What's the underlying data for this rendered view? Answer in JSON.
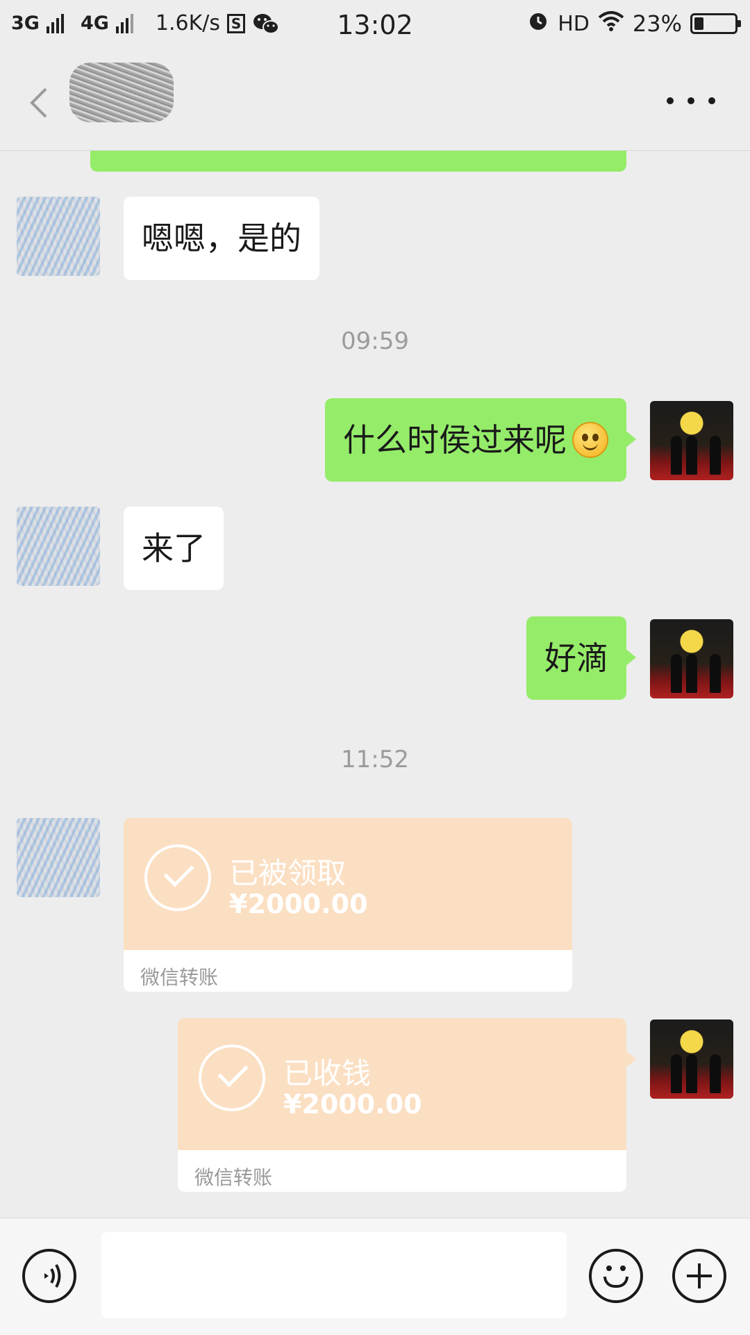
{
  "status_bar": {
    "network1": "3G",
    "network2": "4G",
    "speed": "1.6K/s",
    "s_icon": "S",
    "time": "13:02",
    "hd": "HD",
    "battery_pct": "23%",
    "battery_level": 0.23,
    "icons": [
      "signal-icon",
      "wechat-icon",
      "alarm-icon",
      "wifi-icon",
      "battery-icon"
    ]
  },
  "nav": {
    "back_icon": "chevron-left-icon",
    "more_icon": "more-dots-icon"
  },
  "chat": {
    "messages": [
      {
        "side": "left",
        "type": "text",
        "text": "嗯嗯，是的"
      },
      {
        "type": "timestamp",
        "text": "09:59"
      },
      {
        "side": "right",
        "type": "text",
        "text": "什么时侯过来呢",
        "emoji": "smile-emoji"
      },
      {
        "side": "left",
        "type": "text",
        "text": "来了"
      },
      {
        "side": "right",
        "type": "text",
        "text": "好滴"
      },
      {
        "type": "timestamp",
        "text": "11:52"
      },
      {
        "side": "left",
        "type": "transfer",
        "status": "已被领取",
        "amount": "¥2000.00",
        "footer": "微信转账"
      },
      {
        "side": "right",
        "type": "transfer",
        "status": "已收钱",
        "amount": "¥2000.00",
        "footer": "微信转账"
      }
    ]
  },
  "input_bar": {
    "voice_icon": "voice-icon",
    "emoji_icon": "emoji-icon",
    "plus_icon": "plus-icon",
    "value": "",
    "placeholder": ""
  },
  "colors": {
    "background": "#ededed",
    "bubble_right": "#95ec69",
    "bubble_left": "#ffffff",
    "transfer": "#fbdfc2",
    "timestamp": "#9b9b9b"
  }
}
